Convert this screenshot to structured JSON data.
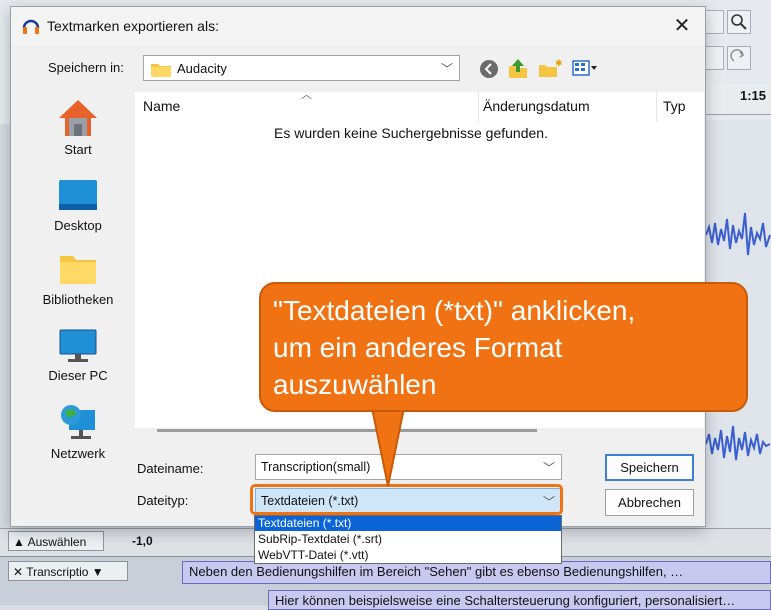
{
  "app": {
    "ruler_time": "1:15",
    "select_button": "Auswählen",
    "gain_value": "-1,0",
    "track_name": "Transcriptio",
    "label_line1": "Neben den Bedienungshilfen im Bereich \"Sehen\" gibt es ebenso Bedienungshilfen, …",
    "label_line2": "Hier können beispielsweise eine Schaltersteuerung konfiguriert, personalisiert…"
  },
  "dialog": {
    "title": "Textmarken exportieren als:",
    "save_in_label": "Speichern in:",
    "save_in_value": "Audacity",
    "places": [
      "Start",
      "Desktop",
      "Bibliotheken",
      "Dieser PC",
      "Netzwerk"
    ],
    "columns": {
      "name": "Name",
      "modified": "Änderungsdatum",
      "type": "Typ"
    },
    "empty_message": "Es wurden keine Suchergebnisse gefunden.",
    "filename_label": "Dateiname:",
    "filename_value": "Transcription(small)",
    "filetype_label": "Dateityp:",
    "filetype_value": "Textdateien (*.txt)",
    "save_button": "Speichern",
    "cancel_button": "Abbrechen",
    "filetype_options": [
      "Textdateien (*.txt)",
      "SubRip-Textdatei (*.srt)",
      "WebVTT-Datei (*.vtt)"
    ]
  },
  "callout": {
    "line1": "\"Textdateien (*txt)\" anklicken,",
    "line2": "um ein anderes Format",
    "line3": "auszuwählen"
  },
  "colors": {
    "accent": "#f07212",
    "selection": "#0a64d6",
    "label_bg": "#c8c8f0"
  }
}
